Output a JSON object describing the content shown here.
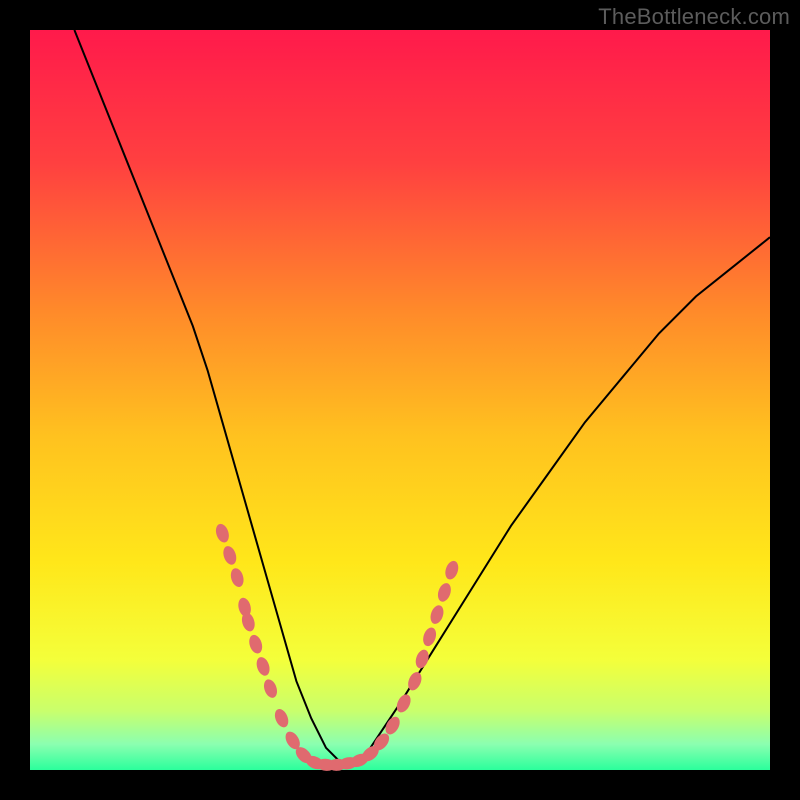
{
  "watermark": "TheBottleneck.com",
  "chart_data": {
    "type": "line",
    "title": "",
    "xlabel": "",
    "ylabel": "",
    "xlim": [
      0,
      100
    ],
    "ylim": [
      0,
      100
    ],
    "background_gradient": {
      "direction": "vertical",
      "stops": [
        {
          "pos": 0.0,
          "color": "#ff1a4b"
        },
        {
          "pos": 0.18,
          "color": "#ff4040"
        },
        {
          "pos": 0.38,
          "color": "#ff8a2a"
        },
        {
          "pos": 0.55,
          "color": "#ffc21f"
        },
        {
          "pos": 0.72,
          "color": "#ffe71a"
        },
        {
          "pos": 0.85,
          "color": "#f4ff3a"
        },
        {
          "pos": 0.92,
          "color": "#c9ff6c"
        },
        {
          "pos": 0.965,
          "color": "#8bffb0"
        },
        {
          "pos": 1.0,
          "color": "#2bff9c"
        }
      ]
    },
    "series": [
      {
        "name": "bottleneck-curve",
        "color": "#000000",
        "stroke_width": 2,
        "x": [
          6,
          10,
          14,
          18,
          22,
          24,
          26,
          28,
          30,
          32,
          34,
          36,
          38,
          40,
          42,
          44,
          46,
          50,
          55,
          60,
          65,
          70,
          75,
          80,
          85,
          90,
          95,
          100
        ],
        "y": [
          100,
          90,
          80,
          70,
          60,
          54,
          47,
          40,
          33,
          26,
          19,
          12,
          7,
          3,
          1,
          1,
          3,
          9,
          17,
          25,
          33,
          40,
          47,
          53,
          59,
          64,
          68,
          72
        ]
      }
    ],
    "markers": {
      "name": "highlight-dots",
      "color": "#e06a6f",
      "radius": 6,
      "points": [
        {
          "x": 26,
          "y": 32
        },
        {
          "x": 27,
          "y": 29
        },
        {
          "x": 28,
          "y": 26
        },
        {
          "x": 29,
          "y": 22
        },
        {
          "x": 29.5,
          "y": 20
        },
        {
          "x": 30.5,
          "y": 17
        },
        {
          "x": 31.5,
          "y": 14
        },
        {
          "x": 32.5,
          "y": 11
        },
        {
          "x": 34,
          "y": 7
        },
        {
          "x": 35.5,
          "y": 4
        },
        {
          "x": 37,
          "y": 2
        },
        {
          "x": 38.5,
          "y": 1
        },
        {
          "x": 40,
          "y": 0.7
        },
        {
          "x": 41.5,
          "y": 0.7
        },
        {
          "x": 43,
          "y": 0.9
        },
        {
          "x": 44.5,
          "y": 1.3
        },
        {
          "x": 46,
          "y": 2.2
        },
        {
          "x": 47.5,
          "y": 3.8
        },
        {
          "x": 49,
          "y": 6
        },
        {
          "x": 50.5,
          "y": 9
        },
        {
          "x": 52,
          "y": 12
        },
        {
          "x": 53,
          "y": 15
        },
        {
          "x": 54,
          "y": 18
        },
        {
          "x": 55,
          "y": 21
        },
        {
          "x": 56,
          "y": 24
        },
        {
          "x": 57,
          "y": 27
        }
      ]
    }
  }
}
